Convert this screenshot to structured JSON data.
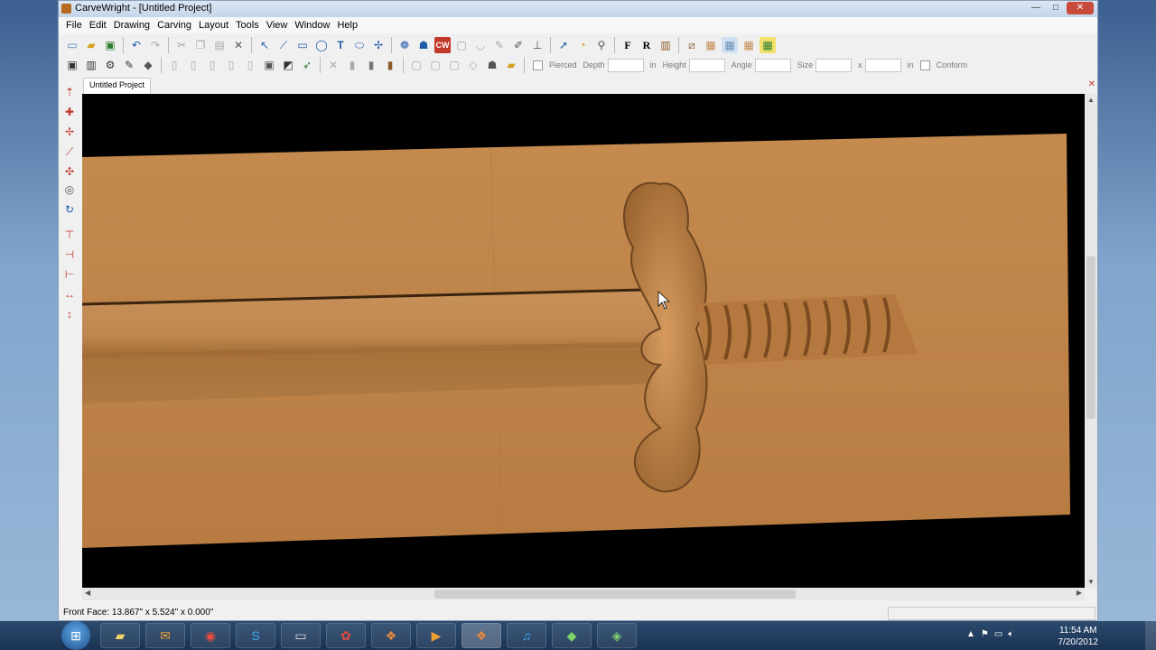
{
  "window": {
    "title": "CarveWright - [Untitled Project]",
    "buttons": [
      "—",
      "□",
      "✕"
    ]
  },
  "menu": [
    "File",
    "Edit",
    "Drawing",
    "Carving",
    "Layout",
    "Tools",
    "View",
    "Window",
    "Help"
  ],
  "toolbar1_icons": [
    "new-icon",
    "open-icon",
    "save-icon",
    "undo-icon",
    "redo-icon",
    "cut-icon",
    "copy-icon",
    "paste-icon",
    "delete-icon",
    "select-icon",
    "line-icon",
    "rectangle-icon",
    "circle-icon",
    "text-icon",
    "ellipse-icon",
    "node-icon",
    "patterns-icon",
    "library-icon",
    "cw-icon",
    "box-icon",
    "bowl-icon",
    "pen-icon",
    "brush-icon",
    "stamp-icon",
    "pointer-icon",
    "measure-icon",
    "zoom-icon",
    "font-f-icon",
    "font-r-icon",
    "layer-icon",
    "tile-1-icon",
    "tile-2-icon",
    "tile-3-icon",
    "tile-4-icon",
    "tile-5-icon"
  ],
  "toolbar2": {
    "pierced_label": "Pierced",
    "depth_label": "Depth",
    "depth_unit": "in",
    "height_label": "Height",
    "angle_label": "Angle",
    "size_label": "Size",
    "size_x": "x",
    "size_unit": "in",
    "conform_label": "Conform"
  },
  "tab": {
    "label": "Untitled Project",
    "close": "✕"
  },
  "status": {
    "text": "Front Face: 13.867\" x 5.524\" x 0.000\""
  },
  "taskbar": {
    "start_glyph": "⊞",
    "time": "11:54 AM",
    "date": "7/20/2012"
  },
  "colors": {
    "board": "#c48a4e",
    "board_dark": "#a8713a",
    "viewport_bg": "#000000"
  }
}
